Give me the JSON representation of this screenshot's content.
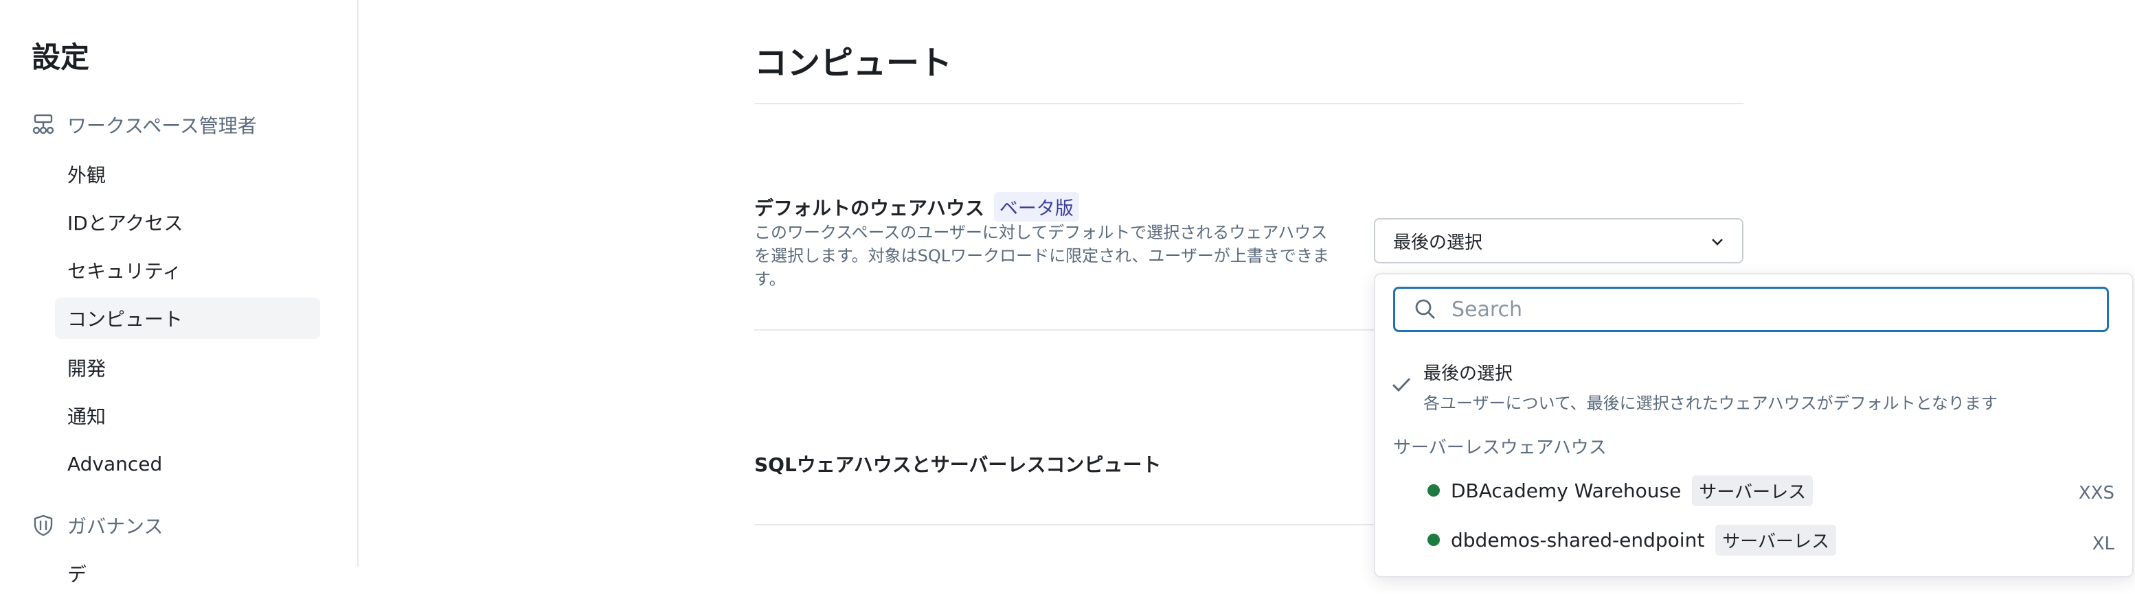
{
  "sidebar": {
    "title": "設定",
    "workspace_admin": {
      "label": "ワークスペース管理者",
      "icon": "workspace-admin-icon"
    },
    "items": [
      {
        "label": "外観"
      },
      {
        "label": "IDとアクセス"
      },
      {
        "label": "セキュリティ"
      },
      {
        "label": "コンピュート",
        "active": true
      },
      {
        "label": "開発"
      },
      {
        "label": "通知"
      },
      {
        "label": "Advanced"
      }
    ],
    "governance": {
      "label": "ガバナンス",
      "icon": "shield-icon"
    },
    "partial_item": "デ"
  },
  "main": {
    "title": "コンピュート",
    "default_warehouse": {
      "label": "デフォルトのウェアハウス",
      "beta": "ベータ版",
      "description": "このワークスペースのユーザーに対してデフォルトで選択されるウェアハウスを選択します。対象はSQLワークロードに限定され、ユーザーが上書きできます。",
      "selected_value": "最後の選択"
    },
    "sql_section_label": "SQLウェアハウスとサーバーレスコンピュート"
  },
  "dropdown": {
    "search_placeholder": "Search",
    "last_selection": {
      "title": "最後の選択",
      "description": "各ユーザーについて、最後に選択されたウェアハウスがデフォルトとなります"
    },
    "section_header": "サーバーレスウェアハウス",
    "warehouses": [
      {
        "name": "DBAcademy Warehouse",
        "tag": "サーバーレス",
        "size": "XXS",
        "status_color": "#1e7a3e"
      },
      {
        "name": "dbdemos-shared-endpoint",
        "tag": "サーバーレス",
        "size": "XL",
        "status_color": "#1e7a3e"
      }
    ]
  },
  "colors": {
    "accent": "#2272b4",
    "status_running": "#1e7a3e",
    "beta_text": "#3b3f9a"
  }
}
